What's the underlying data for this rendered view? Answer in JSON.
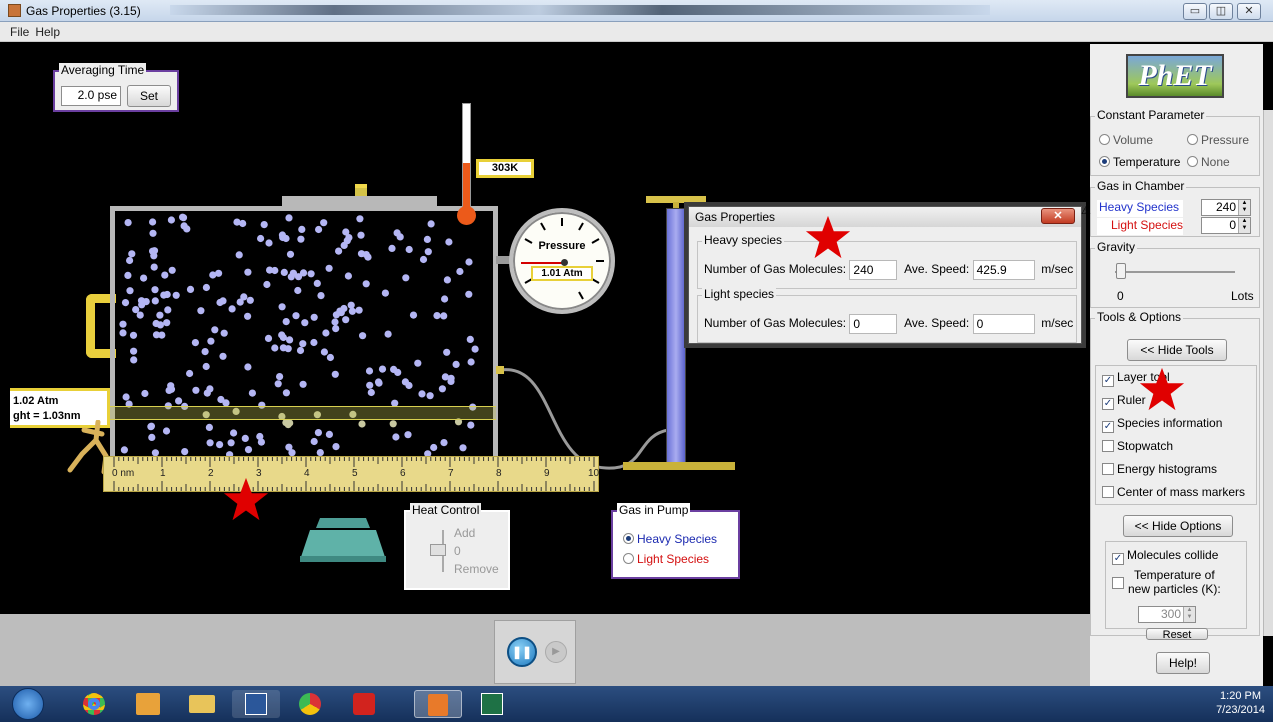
{
  "window": {
    "title": "Gas Properties (3.15)",
    "min_glyph": "▭",
    "max_glyph": "◫",
    "close_glyph": "✕"
  },
  "menu": [
    "File",
    "Help"
  ],
  "averaging_time": {
    "legend": "Averaging Time",
    "value": "2.0",
    "unit": "pse",
    "set_label": "Set"
  },
  "thermometer": {
    "readout": "303K",
    "level": 0.45
  },
  "pressure_gauge": {
    "label": "Pressure",
    "readout": "1.01 Atm"
  },
  "layer_tool": {
    "line1": "1.02 Atm",
    "line2": "ght = 1.03nm"
  },
  "ruler": {
    "labels": [
      "0 nm",
      "1",
      "2",
      "3",
      "4",
      "5",
      "6",
      "7",
      "8",
      "9",
      "10"
    ]
  },
  "species_dialog": {
    "title": "Gas Properties",
    "close_glyph": "✕",
    "heavy": {
      "legend": "Heavy species",
      "count_label": "Number of Gas Molecules:",
      "count": "240",
      "speed_label": "Ave. Speed:",
      "speed": "425.9",
      "unit": "m/sec"
    },
    "light": {
      "legend": "Light species",
      "count_label": "Number of Gas Molecules:",
      "count": "0",
      "speed_label": "Ave. Speed:",
      "speed": "0",
      "unit": "m/sec"
    }
  },
  "heat_control": {
    "legend": "Heat Control",
    "add": "Add",
    "zero": "0",
    "remove": "Remove"
  },
  "gas_in_pump": {
    "legend": "Gas in Pump",
    "heavy": "Heavy Species",
    "light": "Light Species",
    "selected": "Heavy Species"
  },
  "playback": {
    "pause_glyph": "❚❚",
    "step_glyph": "▶"
  },
  "right_panel": {
    "logo": "PhET",
    "constant_parameter": {
      "legend": "Constant Parameter",
      "volume": "Volume",
      "pressure": "Pressure",
      "temperature": "Temperature",
      "none": "None",
      "selected": "Temperature"
    },
    "gas_in_chamber": {
      "legend": "Gas in Chamber",
      "heavy_label": "Heavy Species",
      "heavy_value": "240",
      "light_label": "Light Species",
      "light_value": "0"
    },
    "gravity": {
      "legend": "Gravity",
      "min_label": "0",
      "max_label": "Lots",
      "level": 0
    },
    "tools_options": {
      "legend": "Tools & Options",
      "hide_tools": "<< Hide Tools"
    },
    "tools": [
      {
        "label": "Layer tool",
        "checked": true
      },
      {
        "label": "Ruler",
        "checked": true
      },
      {
        "label": "Species information",
        "checked": true
      },
      {
        "label": "Stopwatch",
        "checked": false
      },
      {
        "label": "Energy histograms",
        "checked": false
      },
      {
        "label": "Center of mass markers",
        "checked": false
      }
    ],
    "hide_options": "<< Hide Options",
    "molecules_collide": "Molecules collide",
    "temp_new_line1": "Temperature of",
    "temp_new_line2": "new particles (K):",
    "temp_new_value": "300",
    "reset": "Reset",
    "help": "Help!"
  },
  "taskbar": {
    "time": "1:20 PM",
    "date": "7/23/2014"
  }
}
